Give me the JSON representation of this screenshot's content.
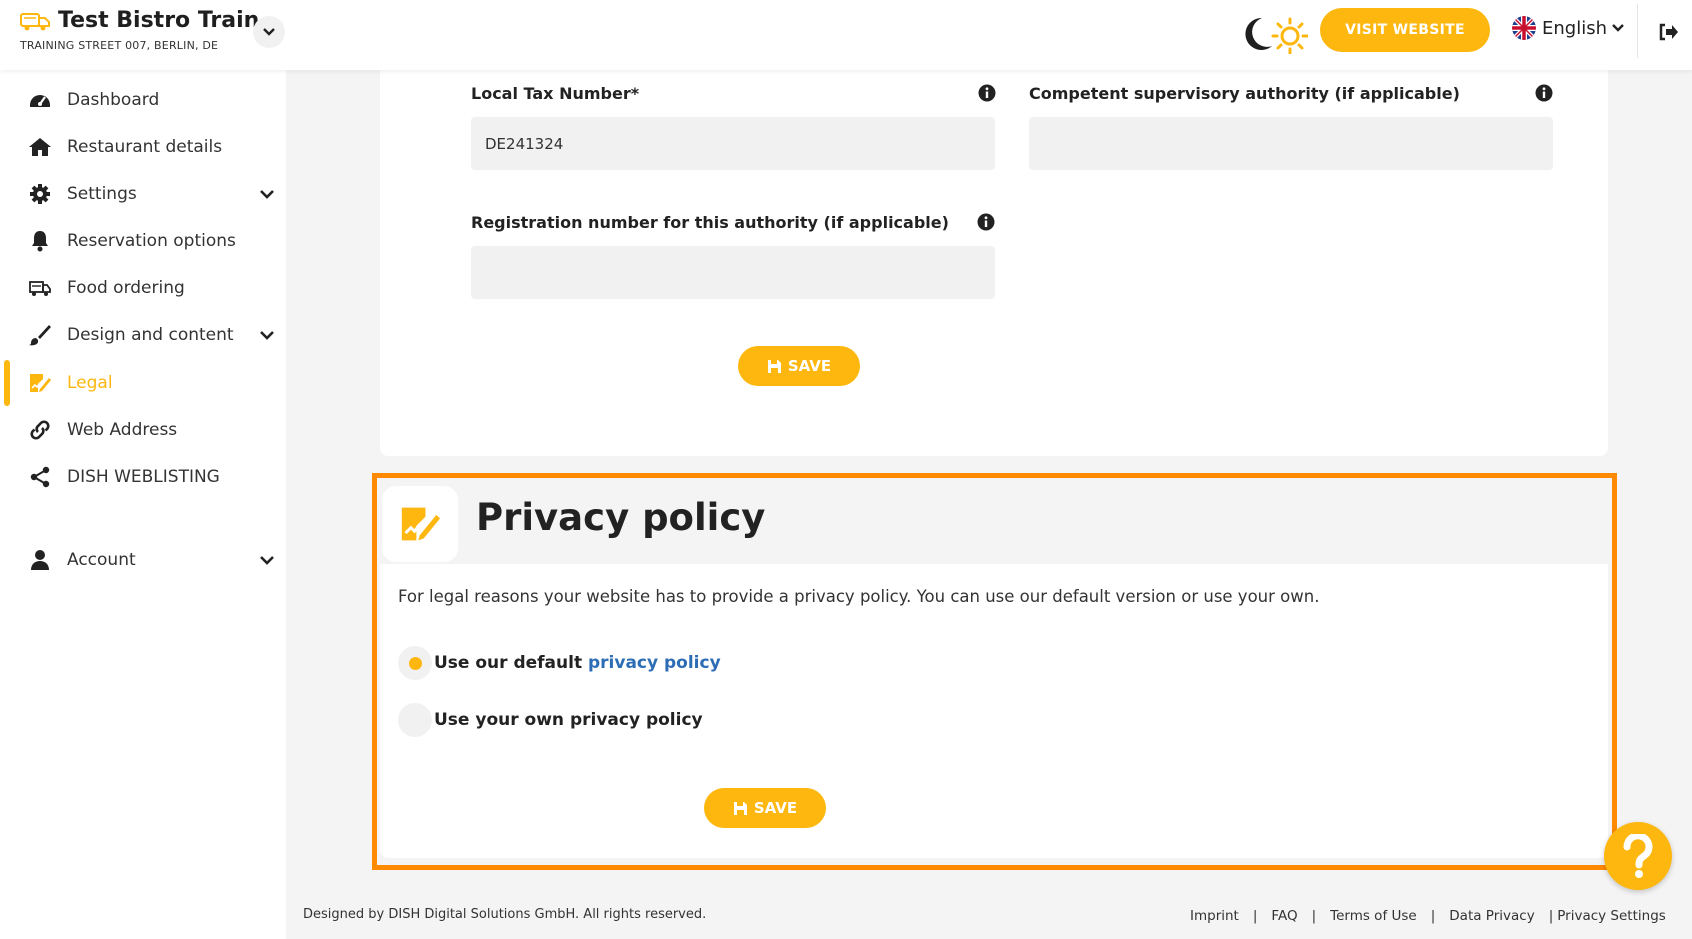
{
  "header": {
    "restaurant_name": "Test Bistro Train...",
    "address": "TRAINING STREET 007, BERLIN, DE",
    "visit_website": "VISIT WEBSITE",
    "language": "English"
  },
  "sidebar": {
    "items": [
      {
        "label": "Dashboard",
        "icon": "dashboard-icon"
      },
      {
        "label": "Restaurant details",
        "icon": "home-icon"
      },
      {
        "label": "Settings",
        "icon": "gear-icon"
      },
      {
        "label": "Reservation options",
        "icon": "bell-icon"
      },
      {
        "label": "Food ordering",
        "icon": "food-ordering-icon"
      },
      {
        "label": "Design and content",
        "icon": "brush-icon"
      },
      {
        "label": "Legal",
        "icon": "legal-icon"
      },
      {
        "label": "Web Address",
        "icon": "link-icon"
      },
      {
        "label": "DISH WEBLISTING",
        "icon": "share-icon"
      },
      {
        "label": "Account",
        "icon": "user-icon"
      }
    ],
    "active": "Legal"
  },
  "legal_form": {
    "local_tax_label": "Local Tax Number*",
    "local_tax_value": "DE241324",
    "authority_label": "Competent supervisory authority (if applicable)",
    "authority_value": "",
    "registration_label": "Registration number for this authority (if applicable)",
    "registration_value": "",
    "save_label": "SAVE"
  },
  "privacy": {
    "title": "Privacy policy",
    "description": "For legal reasons your website has to provide a privacy policy. You can use our default version or use your own.",
    "option_default_prefix": "Use our default ",
    "option_default_link": "privacy policy",
    "option_own": "Use your own privacy policy",
    "selected": "default",
    "save_label": "SAVE"
  },
  "footer": {
    "copyright": "Designed by DISH Digital Solutions GmbH. All rights reserved.",
    "links": [
      "Imprint",
      "FAQ",
      "Terms of Use",
      "Data Privacy",
      "Privacy Settings"
    ]
  },
  "colors": {
    "accent": "#fdb70f",
    "highlight": "#ff8a00",
    "link": "#2d6db5"
  }
}
